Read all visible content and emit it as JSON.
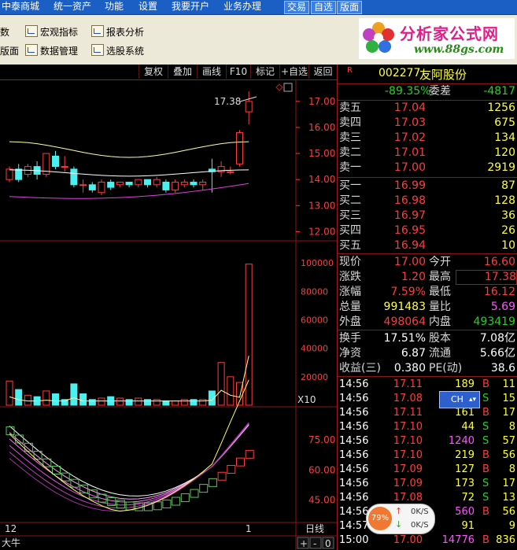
{
  "menu": {
    "items": [
      "中泰商城",
      "统一资产",
      "功能",
      "设置",
      "我要开户",
      "业务办理"
    ],
    "right_buttons": [
      "交易",
      "自选",
      "版面"
    ]
  },
  "toolbar": {
    "row1": [
      "数",
      "宏观指标",
      "报表分析"
    ],
    "row2": [
      "版面",
      "数据管理",
      "选股系统"
    ]
  },
  "logo": {
    "title": "分析家公式网",
    "url": "www.88gs.com"
  },
  "chart_buttons": [
    "复权",
    "叠加",
    "画线",
    "F10",
    "标记",
    "+自选",
    "返回"
  ],
  "stock": {
    "code": "002277",
    "name": "友阿股份",
    "badge": "R"
  },
  "summary": {
    "weibi_label": "委比",
    "weibi": "-89.35%",
    "weicha_label": "委差",
    "weicha": "-4817"
  },
  "asks": [
    {
      "label": "卖五",
      "price": "17.04",
      "vol": "1256"
    },
    {
      "label": "卖四",
      "price": "17.03",
      "vol": "675"
    },
    {
      "label": "卖三",
      "price": "17.02",
      "vol": "134"
    },
    {
      "label": "卖二",
      "price": "17.01",
      "vol": "120"
    },
    {
      "label": "卖一",
      "price": "17.00",
      "vol": "2919"
    }
  ],
  "bids": [
    {
      "label": "买一",
      "price": "16.99",
      "vol": "87"
    },
    {
      "label": "买二",
      "price": "16.98",
      "vol": "128"
    },
    {
      "label": "买三",
      "price": "16.97",
      "vol": "36"
    },
    {
      "label": "买四",
      "price": "16.95",
      "vol": "26"
    },
    {
      "label": "买五",
      "price": "16.94",
      "vol": "10"
    }
  ],
  "stats": [
    {
      "l1": "现价",
      "v1": "17.00",
      "l2": "今开",
      "v2": "16.60"
    },
    {
      "l1": "涨跌",
      "v1": "1.20",
      "l2": "最高",
      "v2": "17.38"
    },
    {
      "l1": "涨幅",
      "v1": "7.59%",
      "l2": "最低",
      "v2": "16.12"
    },
    {
      "l1": "总量",
      "v1": "991483",
      "l2": "量比",
      "v2": "5.69"
    },
    {
      "l1": "外盘",
      "v1": "498064",
      "l2": "内盘",
      "v2": "493419"
    }
  ],
  "stats2": [
    {
      "l1": "换手",
      "v1": "17.51%",
      "l2": "股本",
      "v2": "7.08亿"
    },
    {
      "l1": "净资",
      "v1": "6.87",
      "l2": "流通",
      "v2": "5.66亿"
    },
    {
      "l1": "收益(三)",
      "v1": "0.380",
      "l2": "PE(动)",
      "v2": "38.6"
    }
  ],
  "ticks": [
    {
      "t": "14:56",
      "p": "17.11",
      "v": "189",
      "d": "B",
      "n": "11"
    },
    {
      "t": "14:56",
      "p": "17.08",
      "v": "",
      "d": "S",
      "n": "15"
    },
    {
      "t": "14:56",
      "p": "17.11",
      "v": "161",
      "d": "B",
      "n": "17"
    },
    {
      "t": "14:56",
      "p": "17.10",
      "v": "44",
      "d": "S",
      "n": "8"
    },
    {
      "t": "14:56",
      "p": "17.10",
      "v": "1240",
      "d": "S",
      "n": "57"
    },
    {
      "t": "14:56",
      "p": "17.10",
      "v": "219",
      "d": "B",
      "n": "56"
    },
    {
      "t": "14:56",
      "p": "17.09",
      "v": "127",
      "d": "B",
      "n": "8"
    },
    {
      "t": "14:56",
      "p": "17.09",
      "v": "173",
      "d": "S",
      "n": "17"
    },
    {
      "t": "14:56",
      "p": "17.08",
      "v": "72",
      "d": "S",
      "n": "13"
    },
    {
      "t": "14:56",
      "p": "",
      "v": "560",
      "d": "B",
      "n": "56"
    },
    {
      "t": "14:57",
      "p": "",
      "v": "91",
      "d": "",
      "n": "9"
    },
    {
      "t": "15:00",
      "p": "17.00",
      "v": "14776",
      "d": "B",
      "n": "836"
    }
  ],
  "ch_button": "CH",
  "popup": {
    "percent": "79%",
    "up": "0K/S",
    "down": "0K/S"
  },
  "chart": {
    "price_labels": [
      "17.00",
      "16.00",
      "15.00",
      "14.00",
      "13.00",
      "12.00"
    ],
    "high_label": "17.38",
    "vol_labels": [
      "100000",
      "80000",
      "60000",
      "40000",
      "20000"
    ],
    "vol_unit": "X10",
    "ind_labels": [
      "75.00",
      "60.00",
      "45.00"
    ],
    "x_left": "12",
    "x_right": "1",
    "period": "日线",
    "bottom_left": "大牛",
    "bottom_ctrl": [
      "+",
      "-",
      "0"
    ]
  },
  "chart_data": {
    "type": "candlestick",
    "ylim": [
      11.8,
      17.6
    ],
    "candles": [
      {
        "o": 14.0,
        "c": 14.4,
        "h": 14.5,
        "l": 13.9
      },
      {
        "o": 14.4,
        "c": 14.0,
        "h": 14.6,
        "l": 13.9
      },
      {
        "o": 14.2,
        "c": 14.5,
        "h": 14.6,
        "l": 14.1
      },
      {
        "o": 14.5,
        "c": 14.2,
        "h": 14.7,
        "l": 14.0
      },
      {
        "o": 14.2,
        "c": 15.0,
        "h": 15.0,
        "l": 14.1
      },
      {
        "o": 14.9,
        "c": 14.5,
        "h": 15.1,
        "l": 14.4
      },
      {
        "o": 14.5,
        "c": 14.5,
        "h": 14.9,
        "l": 14.3
      },
      {
        "o": 14.4,
        "c": 13.8,
        "h": 14.5,
        "l": 13.7
      },
      {
        "o": 13.8,
        "c": 13.8,
        "h": 14.0,
        "l": 13.5
      },
      {
        "o": 13.8,
        "c": 13.6,
        "h": 13.9,
        "l": 13.5
      },
      {
        "o": 13.5,
        "c": 13.9,
        "h": 14.0,
        "l": 13.4
      },
      {
        "o": 13.9,
        "c": 13.7,
        "h": 14.0,
        "l": 13.6
      },
      {
        "o": 13.8,
        "c": 13.9,
        "h": 13.9,
        "l": 13.7
      },
      {
        "o": 13.9,
        "c": 13.8,
        "h": 13.9,
        "l": 13.7
      },
      {
        "o": 13.8,
        "c": 14.0,
        "h": 14.0,
        "l": 13.7
      },
      {
        "o": 14.0,
        "c": 13.8,
        "h": 14.0,
        "l": 13.7
      },
      {
        "o": 13.8,
        "c": 14.0,
        "h": 14.1,
        "l": 13.7
      },
      {
        "o": 13.9,
        "c": 13.6,
        "h": 14.0,
        "l": 13.5
      },
      {
        "o": 13.6,
        "c": 13.9,
        "h": 14.0,
        "l": 13.5
      },
      {
        "o": 13.8,
        "c": 13.9,
        "h": 14.0,
        "l": 13.7
      },
      {
        "o": 13.9,
        "c": 13.8,
        "h": 14.0,
        "l": 13.7
      },
      {
        "o": 13.8,
        "c": 13.9,
        "h": 14.0,
        "l": 13.6
      },
      {
        "o": 14.4,
        "c": 14.3,
        "h": 14.8,
        "l": 13.5
      },
      {
        "o": 14.3,
        "c": 14.5,
        "h": 14.7,
        "l": 14.1
      },
      {
        "o": 14.3,
        "c": 14.3,
        "h": 14.5,
        "l": 14.2
      },
      {
        "o": 14.6,
        "c": 15.8,
        "h": 15.9,
        "l": 14.5
      },
      {
        "o": 16.6,
        "c": 17.0,
        "h": 17.38,
        "l": 16.12
      }
    ],
    "volume": [
      17000,
      11000,
      7000,
      6000,
      10000,
      8000,
      4000,
      15000,
      8000,
      4000,
      5000,
      6000,
      5000,
      4000,
      5000,
      4000,
      4000,
      3000,
      3000,
      4000,
      4000,
      4000,
      10000,
      30000,
      20000,
      16000,
      99148
    ],
    "volume_up": [
      true,
      false,
      true,
      false,
      true,
      false,
      false,
      false,
      false,
      false,
      true,
      false,
      true,
      false,
      true,
      false,
      true,
      false,
      true,
      true,
      false,
      true,
      false,
      true,
      true,
      true,
      true
    ],
    "vol_ylim": [
      0,
      110000
    ],
    "ind_ylim": [
      35,
      90
    ]
  }
}
